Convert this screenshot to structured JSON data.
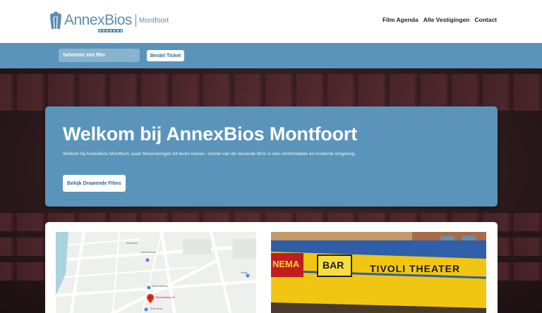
{
  "header": {
    "logo": {
      "brand": "AnnexBios",
      "location": "Montfoort"
    },
    "nav": [
      "Film Agenda",
      "Alle Vestigingen",
      "Contact"
    ]
  },
  "toolbar": {
    "select_placeholder": "Selecteer een film",
    "ticket_button": "Bestel Ticket"
  },
  "hero": {
    "title": "Welkom bij AnnexBios Montfoort",
    "text": "Welkom bij AnnexBios Montfoort, waar filmervaringen tot leven komen. Geniet van de nieuwste films in een comfortabele en moderne omgeving.",
    "button": "Bekijk Draaiende Films"
  },
  "map": {
    "pin_label": "Wijnstraatweg 45",
    "labels": [
      "Kerkstraat",
      "Sandra Baklerij",
      "Singel",
      "Gasthuisstraat",
      "Rode Kruis"
    ]
  },
  "photo": {
    "signs": [
      "NEMA",
      "BAR",
      "TIVOLI THEATER"
    ]
  },
  "colors": {
    "brand": "#5a94ba",
    "brand_dark": "#2f6790",
    "header_bg": "#ffffff"
  }
}
